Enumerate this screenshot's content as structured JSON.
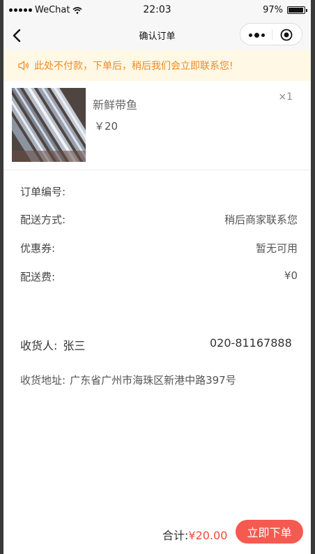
{
  "status_bar": {
    "carrier": "WeChat",
    "time": "22:03",
    "battery": "97%",
    "battery_level": 0.97
  },
  "nav": {
    "title": "确认订单"
  },
  "notice": {
    "text": "此处不付款，下单后，稍后我们会立即联系您!"
  },
  "product": {
    "name": "新鲜带鱼",
    "price": "￥20",
    "quantity": "×1"
  },
  "order_info": [
    {
      "label": "订单编号:",
      "value": ""
    },
    {
      "label": "配送方式:",
      "value": "稍后商家联系您"
    },
    {
      "label": "优惠券:",
      "value": "暂无可用"
    },
    {
      "label": "配送费:",
      "value": "¥0"
    }
  ],
  "receiver": {
    "label": "收货人:",
    "name": "张三",
    "phone": "020-81167888"
  },
  "address": {
    "label": "收货地址:",
    "value": "广东省广州市海珠区新港中路397号"
  },
  "footer": {
    "total_label": "合计:",
    "total_amount": "¥20.00",
    "submit_label": "立即下单"
  },
  "colors": {
    "accent": "#f45a50",
    "notice_text": "#f08a22",
    "notice_bg": "#fff8e5"
  }
}
